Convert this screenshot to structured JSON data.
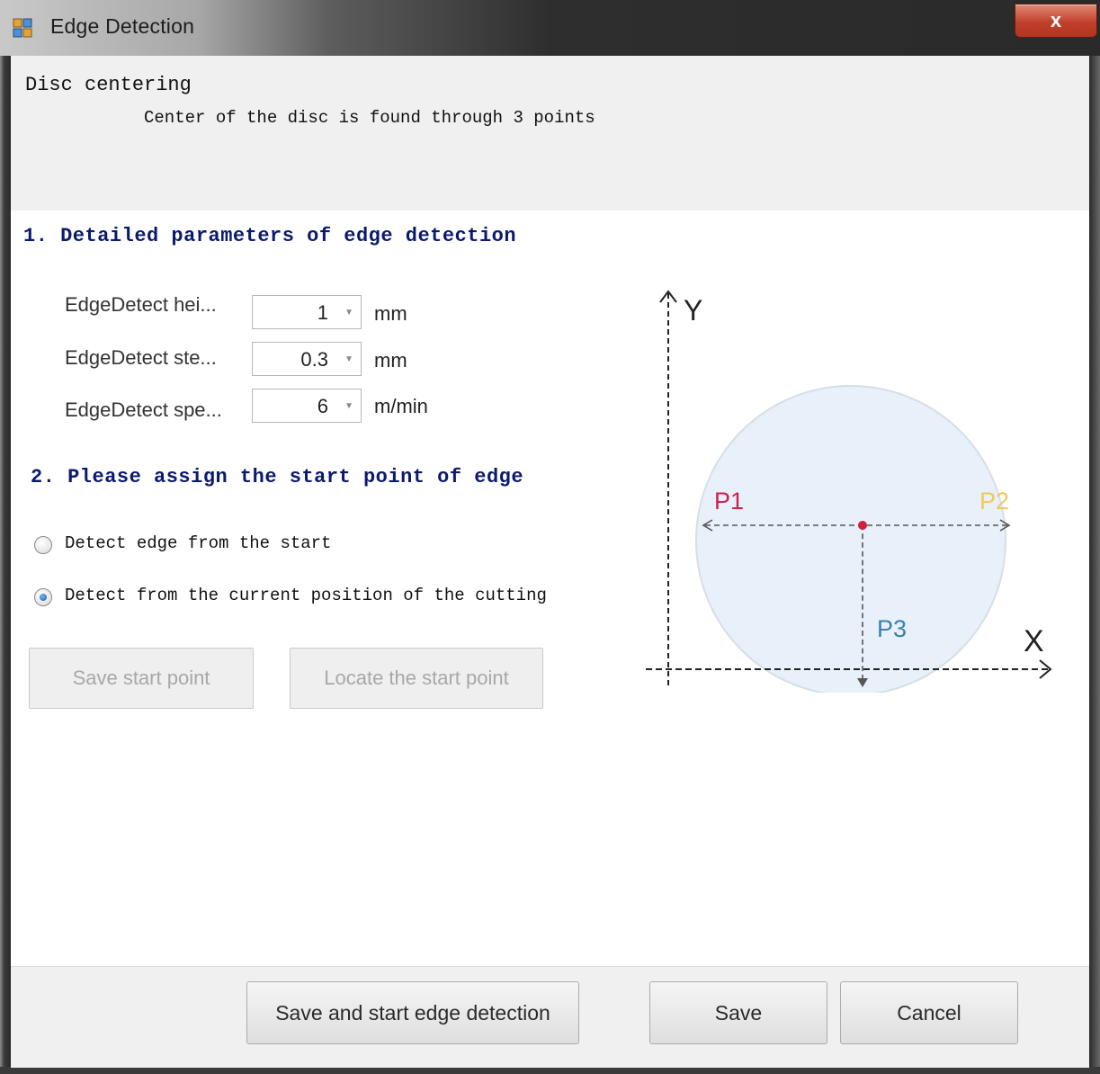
{
  "window": {
    "title": "Edge Detection",
    "close_glyph": "x"
  },
  "header": {
    "title": "Disc centering",
    "subtitle": "Center of the disc is found through 3 points"
  },
  "section1": {
    "title": "1. Detailed parameters of edge detection",
    "params": [
      {
        "label": "EdgeDetect hei...",
        "value": "1",
        "unit": "mm"
      },
      {
        "label": "EdgeDetect ste...",
        "value": "0.3",
        "unit": "mm"
      },
      {
        "label": "EdgeDetect spe...",
        "value": "6",
        "unit": "m/min"
      }
    ]
  },
  "section2": {
    "title": "2. Please assign the start point of edge",
    "options": [
      {
        "label": "Detect edge from the start",
        "checked": false
      },
      {
        "label": "Detect from the current position of the cutting",
        "checked": true
      }
    ],
    "save_start_point": "Save start point",
    "locate_start_point": "Locate the start point"
  },
  "diagram": {
    "y_label": "Y",
    "x_label": "X",
    "p1": "P1",
    "p2": "P2",
    "p3": "P3",
    "colors": {
      "p1": "#d21f4b",
      "p2": "#f0c95a",
      "p3": "#3c7fb1",
      "circle_fill": "#e8f1f9",
      "circle_stroke": "#d6dee6",
      "center": "#d21f3c"
    }
  },
  "footer": {
    "save_and_start": "Save and start edge detection",
    "save": "Save",
    "cancel": "Cancel"
  }
}
